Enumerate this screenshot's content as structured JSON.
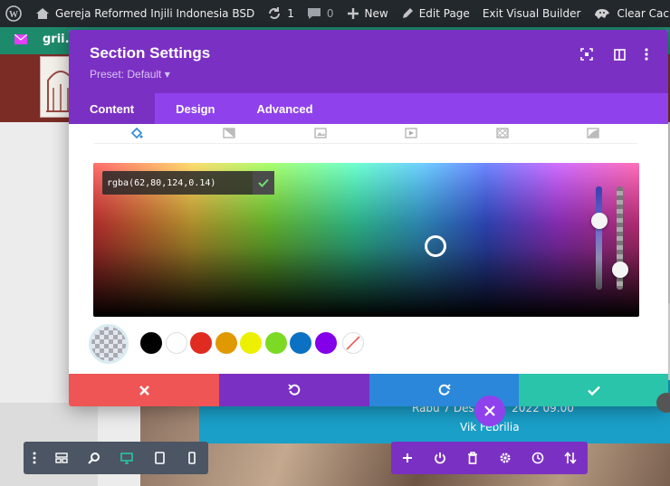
{
  "admin_bar": {
    "site_name": "Gereja Reformed Injili Indonesia BSD",
    "updates_count": "1",
    "comments_count": "0",
    "new_label": "New",
    "edit_page_label": "Edit Page",
    "exit_builder_label": "Exit Visual Builder",
    "clear_cache_label": "Clear Cache"
  },
  "site_nav": {
    "site_text": "grii."
  },
  "modal": {
    "title": "Section Settings",
    "preset": "Preset: Default ▾",
    "tabs": [
      {
        "label": "Content",
        "active": true
      },
      {
        "label": "Design",
        "active": false
      },
      {
        "label": "Advanced",
        "active": false
      }
    ],
    "background_type_icons": [
      "paint-bucket-icon",
      "gradient-icon",
      "image-icon",
      "video-icon",
      "pattern-icon",
      "mask-icon"
    ]
  },
  "color_picker": {
    "value": "rgba(62,80,124,0.14)",
    "hue_level": 0.7,
    "alpha_level": 0.14,
    "swatches": [
      {
        "name": "black",
        "color": "#000000"
      },
      {
        "name": "white",
        "color": "#ffffff"
      },
      {
        "name": "red",
        "color": "#e02b20"
      },
      {
        "name": "orange",
        "color": "#e09900"
      },
      {
        "name": "yellow",
        "color": "#edf000"
      },
      {
        "name": "green",
        "color": "#7cda24"
      },
      {
        "name": "blue",
        "color": "#0c71c3"
      },
      {
        "name": "purple",
        "color": "#8300e9"
      }
    ]
  },
  "action_bar": {
    "colors": {
      "cancel": "#ef5555",
      "undo": "#7b30c4",
      "redo": "#2b87da",
      "save": "#29c4a9"
    }
  },
  "page_content": {
    "date_text": "Rabu 7 Dese",
    "time_text": "2022 09.00",
    "name_text": "Vik Febrilia"
  },
  "colors": {
    "purple": "#7b30c4",
    "purple_light": "#8f42ec",
    "admin_bg": "#23282d"
  }
}
